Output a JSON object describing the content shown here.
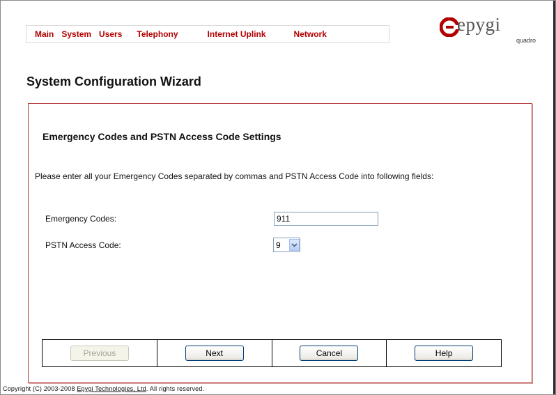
{
  "nav": {
    "items": [
      {
        "label": "Main"
      },
      {
        "label": "System"
      },
      {
        "label": "Users"
      },
      {
        "label": "Telephony"
      },
      {
        "label": "Internet Uplink"
      },
      {
        "label": "Network"
      }
    ]
  },
  "logo": {
    "brand": "epygi",
    "model": "quadro",
    "icon": "epygi-logo-icon",
    "color": "#b20000"
  },
  "page": {
    "title": "System Configuration Wizard"
  },
  "wizard": {
    "heading": "Emergency Codes and PSTN Access Code Settings",
    "instructions": "Please enter all your Emergency Codes separated by commas and PSTN Access Code into following fields:",
    "fields": {
      "emergency_codes": {
        "label": "Emergency Codes:",
        "value": "911"
      },
      "pstn_access_code": {
        "label": "PSTN Access Code:",
        "value": "9"
      }
    },
    "buttons": {
      "previous": "Previous",
      "next": "Next",
      "cancel": "Cancel",
      "help": "Help"
    }
  },
  "footer": {
    "prefix": "Copyright (C) 2003-2008 ",
    "link": "Epygi Technologies, Ltd",
    "suffix": ". All rights reserved."
  },
  "colors": {
    "accent": "#b20000",
    "wizard_border": "#b63a3a"
  }
}
